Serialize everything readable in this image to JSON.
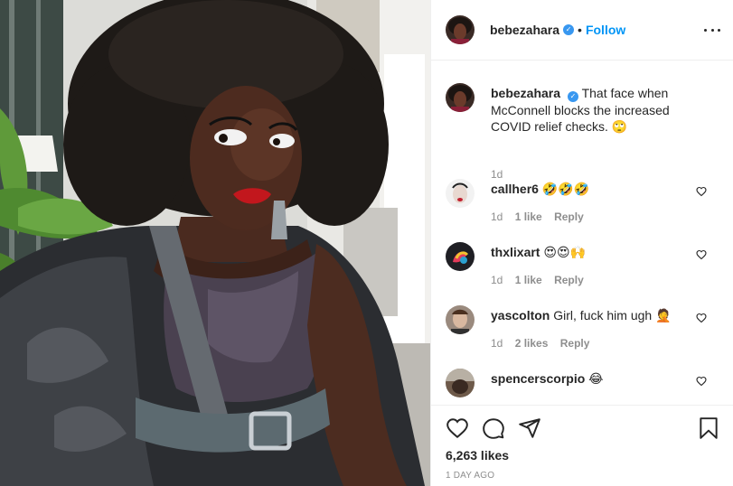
{
  "header": {
    "username": "bebezahara",
    "separator": "•",
    "follow_label": "Follow",
    "verified_glyph": "✓"
  },
  "caption": {
    "username": "bebezahara",
    "text": "That face when McConnell blocks the increased COVID relief checks.",
    "emoji": "🙄",
    "time": "1d"
  },
  "comments": [
    {
      "username": "callher6",
      "text": "",
      "emoji": "🤣🤣🤣",
      "time": "1d",
      "likes": "1 like",
      "reply": "Reply",
      "avatar_color": "#f2f2f2"
    },
    {
      "username": "thxlixart",
      "text": "",
      "emoji": "😍😍🙌",
      "time": "1d",
      "likes": "1 like",
      "reply": "Reply",
      "avatar_color": "#222222"
    },
    {
      "username": "yascolton",
      "text": "Girl, fuck him ugh",
      "emoji": "🤦",
      "time": "1d",
      "likes": "2 likes",
      "reply": "Reply",
      "avatar_color": "#9a8a7e"
    },
    {
      "username": "spencerscorpio",
      "text": "",
      "emoji": "😂",
      "time": "",
      "likes": "",
      "reply": "",
      "avatar_color": "#6e5a4a"
    }
  ],
  "actions": {
    "likes": "6,263 likes",
    "posted": "1 DAY AGO"
  },
  "colors": {
    "link_blue": "#0095f6",
    "verified_blue": "#3897f0",
    "muted": "#8e8e8e",
    "text": "#262626"
  },
  "icons": [
    "heart-icon",
    "comment-icon",
    "share-icon",
    "bookmark-icon",
    "more-options-icon",
    "verified-icon"
  ]
}
